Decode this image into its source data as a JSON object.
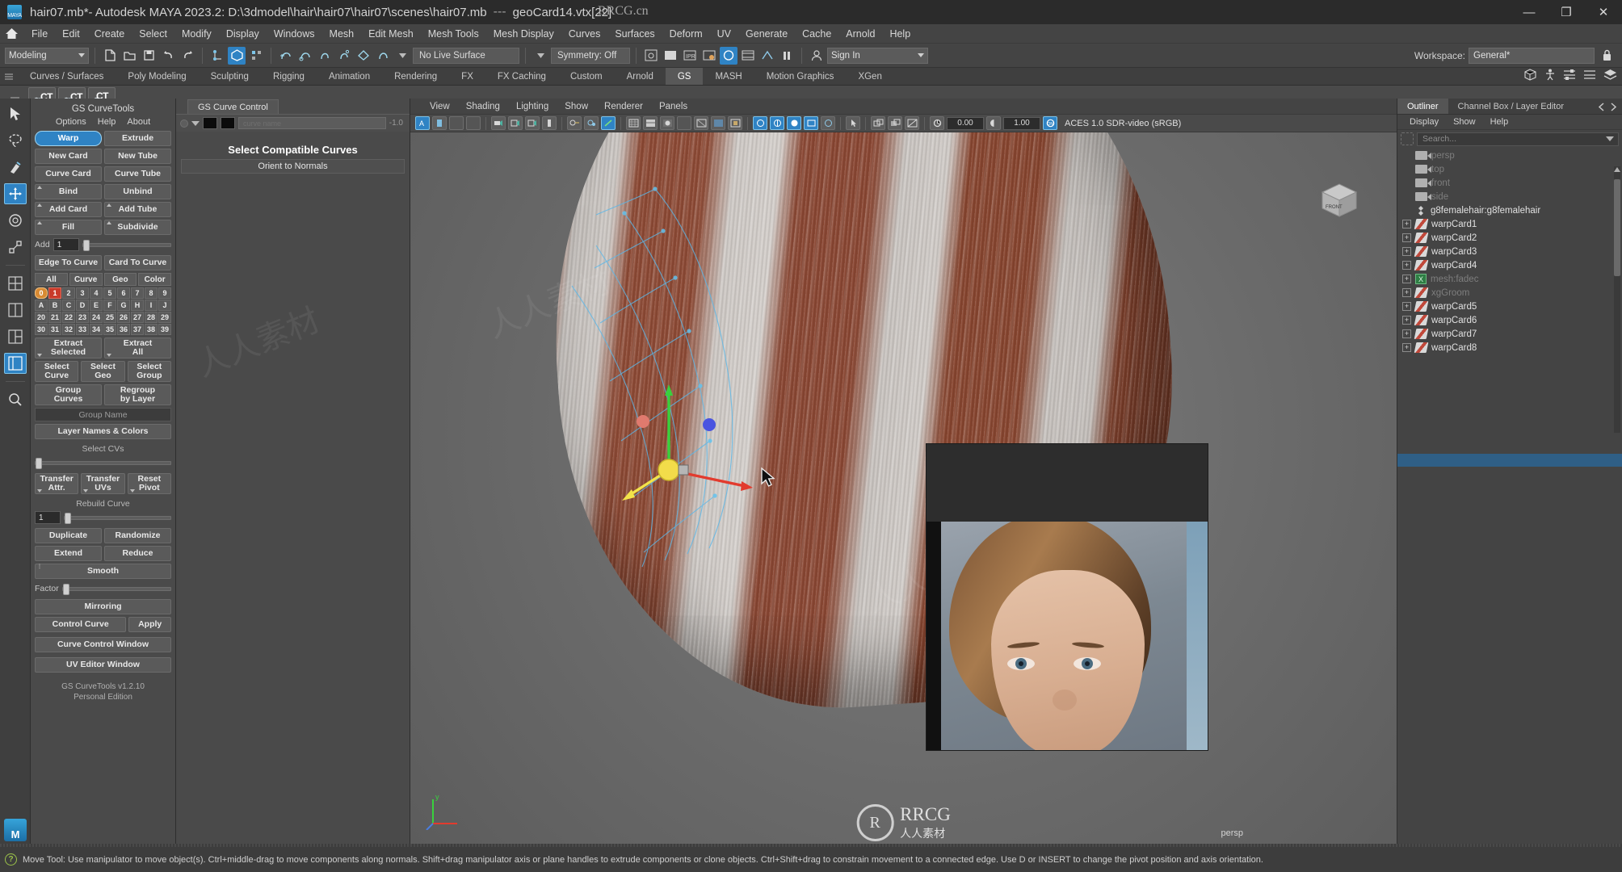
{
  "titlebar": {
    "doc": "hair07.mb*",
    "app": " - Autodesk MAYA 2023.2: D:\\3dmodel\\hair\\hair07\\hair07\\scenes\\hair07.mb",
    "sep": "---",
    "selection": "geoCard14.vtx[22]",
    "logo_text": "MAYA",
    "watermark": "RRCG.cn",
    "minimize": "—",
    "maximize": "❐",
    "close": "✕"
  },
  "menubar": {
    "home_icon": "home-icon",
    "items": [
      "File",
      "Edit",
      "Create",
      "Select",
      "Modify",
      "Display",
      "Windows",
      "Mesh",
      "Edit Mesh",
      "Mesh Tools",
      "Mesh Display",
      "Curves",
      "Surfaces",
      "Deform",
      "UV",
      "Generate",
      "Cache",
      "Arnold",
      "Help"
    ]
  },
  "toolbar": {
    "menuset": "Modeling",
    "live_surface": "No Live Surface",
    "symmetry": "Symmetry: Off",
    "workspace_label": "Workspace:",
    "workspace_value": "General*",
    "lock_icon": "lock-icon"
  },
  "shelf": {
    "tabs": [
      "Curves / Surfaces",
      "Poly Modeling",
      "Sculpting",
      "Rigging",
      "Animation",
      "Rendering",
      "FX",
      "FX Caching",
      "Custom",
      "Arnold",
      "GS",
      "MASH",
      "Motion Graphics",
      "XGen"
    ],
    "active": "GS",
    "icons": [
      {
        "label": "CT",
        "sub": "UI",
        "sub_color": "#6fc2e8"
      },
      {
        "label": "CT",
        "sub": "C",
        "sub_color": "#e0a35a"
      },
      {
        "label": "CT",
        "sub": "DEL",
        "sub_color": "#e0a35a"
      }
    ]
  },
  "gs_curvetools": {
    "title": "GS CurveTools",
    "menu": [
      "Options",
      "Help",
      "About"
    ],
    "rows": [
      [
        {
          "label": "Warp",
          "selected": true
        },
        {
          "label": "Extrude"
        }
      ],
      [
        {
          "label": "New Card"
        },
        {
          "label": "New Tube"
        }
      ],
      [
        {
          "label": "Curve Card"
        },
        {
          "label": "Curve Tube"
        }
      ],
      [
        {
          "label": "Bind",
          "corner": true
        },
        {
          "label": "Unbind"
        }
      ],
      [
        {
          "label": "Add Card",
          "corner": true
        },
        {
          "label": "Add Tube",
          "corner": true
        }
      ],
      [
        {
          "label": "Fill",
          "corner": true
        },
        {
          "label": "Subdivide",
          "corner": true
        }
      ]
    ],
    "add_slider": {
      "label": "Add",
      "value": "1"
    },
    "curve_row": [
      {
        "label": "Edge To Curve"
      },
      {
        "label": "Card To Curve"
      }
    ],
    "filter_tabs": [
      {
        "label": "All",
        "corner": true
      },
      {
        "label": "Curve"
      },
      {
        "label": "Geo"
      },
      {
        "label": "Color"
      }
    ],
    "grid_row1": [
      "0",
      "1",
      "2",
      "3",
      "4",
      "5",
      "6",
      "7",
      "8",
      "9"
    ],
    "grid_row2": [
      "A",
      "B",
      "C",
      "D",
      "E",
      "F",
      "G",
      "H",
      "I",
      "J"
    ],
    "grid_row3": [
      "20",
      "21",
      "22",
      "23",
      "24",
      "25",
      "26",
      "27",
      "28",
      "29"
    ],
    "grid_row4": [
      "30",
      "31",
      "32",
      "33",
      "34",
      "35",
      "36",
      "37",
      "38",
      "39"
    ],
    "extract_row": [
      {
        "label": "Extract\nSelected"
      },
      {
        "label": "Extract\nAll"
      }
    ],
    "select_row": [
      {
        "label": "Select\nCurve"
      },
      {
        "label": "Select\nGeo"
      },
      {
        "label": "Select\nGroup"
      }
    ],
    "group_row": [
      {
        "label": "Group\nCurves"
      },
      {
        "label": "Regroup\nby Layer"
      }
    ],
    "group_name_field": "Group Name",
    "layer_names_btn": "Layer Names & Colors",
    "select_cvs_label": "Select CVs",
    "transfer_row": [
      {
        "label": "Transfer\nAttr."
      },
      {
        "label": "Transfer\nUVs"
      },
      {
        "label": "Reset\nPivot"
      }
    ],
    "rebuild_label": "Rebuild Curve",
    "rebuild_value": "1",
    "dup_row": [
      {
        "label": "Duplicate"
      },
      {
        "label": "Randomize"
      }
    ],
    "ext_row": [
      {
        "label": "Extend"
      },
      {
        "label": "Reduce"
      }
    ],
    "smooth_btn": "Smooth",
    "factor_label": "Factor",
    "mirroring_btn": "Mirroring",
    "control_row": [
      {
        "label": "Control Curve"
      },
      {
        "label": "Apply"
      }
    ],
    "curve_control_window_btn": "Curve Control Window",
    "uv_editor_window_btn": "UV Editor Window",
    "footer_line1": "GS CurveTools v1.2.10",
    "footer_line2": "Personal Edition"
  },
  "gs_curve_control": {
    "tab": "GS Curve Control",
    "value": "-1.0",
    "input_placeholder": "curve name",
    "title_btn": "Select Compatible Curves",
    "sub_btn": "Orient to Normals"
  },
  "viewport": {
    "menus": [
      "View",
      "Shading",
      "Lighting",
      "Show",
      "Renderer",
      "Panels"
    ],
    "exposure": "0.00",
    "gamma": "1.00",
    "colorspace": "ACES 1.0 SDR-video (sRGB)",
    "camera_label": "persp",
    "viewcube_label": "FRONT",
    "axis_label": "y",
    "watermark_logo": "R",
    "watermark_text_1": "RRCG",
    "watermark_text_2": "人人素材"
  },
  "outliner": {
    "tabs": [
      {
        "label": "Outliner",
        "active": true
      },
      {
        "label": "Channel Box / Layer Editor",
        "active": false
      }
    ],
    "menus": [
      "Display",
      "Show",
      "Help"
    ],
    "search_placeholder": "Search...",
    "items": [
      {
        "label": "persp",
        "icon": "camera-icon",
        "dim": true,
        "expand": false
      },
      {
        "label": "top",
        "icon": "camera-icon",
        "dim": true,
        "expand": false
      },
      {
        "label": "front",
        "icon": "camera-icon",
        "dim": true,
        "expand": false
      },
      {
        "label": "side",
        "icon": "camera-icon",
        "dim": true,
        "expand": false
      },
      {
        "label": "g8femalehair:g8femalehair",
        "icon": "group-icon",
        "dim": false,
        "expand": false
      },
      {
        "label": "warpCard1",
        "icon": "card-icon",
        "dim": false,
        "expand": true
      },
      {
        "label": "warpCard2",
        "icon": "card-icon",
        "dim": false,
        "expand": true
      },
      {
        "label": "warpCard3",
        "icon": "card-icon",
        "dim": false,
        "expand": true
      },
      {
        "label": "warpCard4",
        "icon": "card-icon",
        "dim": false,
        "expand": true
      },
      {
        "label": "mesh:fadec",
        "icon": "mesh-icon",
        "dim": true,
        "expand": true
      },
      {
        "label": "xgGroom",
        "icon": "card-icon",
        "dim": true,
        "expand": true
      },
      {
        "label": "warpCard5",
        "icon": "card-icon",
        "dim": false,
        "expand": true
      },
      {
        "label": "warpCard6",
        "icon": "card-icon",
        "dim": false,
        "expand": true
      },
      {
        "label": "warpCard7",
        "icon": "card-icon",
        "dim": false,
        "expand": true
      },
      {
        "label": "warpCard8",
        "icon": "card-icon",
        "dim": false,
        "expand": true
      }
    ]
  },
  "statusbar": {
    "icon": "help-icon",
    "text": "Move Tool: Use manipulator to move object(s). Ctrl+middle-drag to move components along normals. Shift+drag manipulator axis or plane handles to extrude components or clone objects. Ctrl+Shift+drag to constrain movement to a connected edge. Use D or INSERT to change the pivot position and axis orientation."
  },
  "colors": {
    "accent": "#2f83c4",
    "panel_bg": "#4a4a4a",
    "titlebar_bg": "#2b2b2b",
    "hair_brown": "#8d4a35",
    "hair_silver": "#cdc8c4",
    "status_green": "#9bc24a"
  }
}
